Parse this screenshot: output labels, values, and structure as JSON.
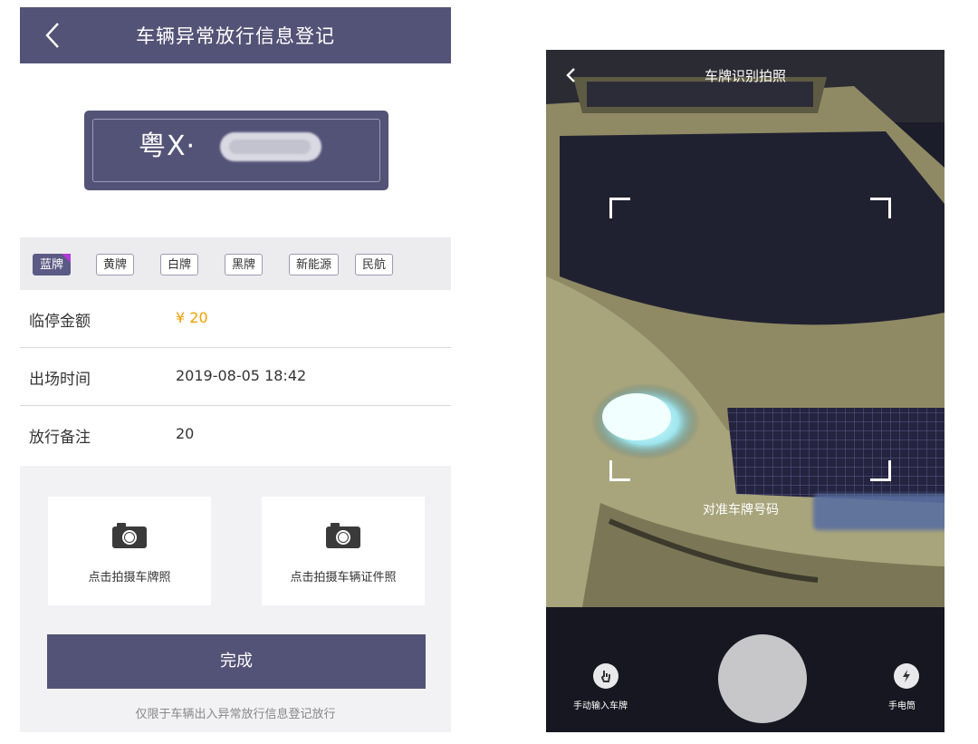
{
  "left_screen": {
    "header": {
      "title": "车辆异常放行信息登记"
    },
    "plate": {
      "prefix": "粤X·"
    },
    "plate_types": [
      {
        "label": "蓝牌",
        "selected": true
      },
      {
        "label": "黄牌",
        "selected": false
      },
      {
        "label": "白牌",
        "selected": false
      },
      {
        "label": "黑牌",
        "selected": false
      },
      {
        "label": "新能源",
        "selected": false
      },
      {
        "label": "民航",
        "selected": false
      }
    ],
    "fields": {
      "fee": {
        "label": "临停金额",
        "value": "¥ 20"
      },
      "exit_time": {
        "label": "出场时间",
        "value": "2019-08-05 18:42"
      },
      "remark": {
        "label": "放行备注",
        "value": "20"
      }
    },
    "photo_cards": {
      "plate_photo": "点击拍摄车牌照",
      "vehicle_doc_photo": "点击拍摄车辆证件照"
    },
    "done_button": "完成",
    "footnote": "仅限于车辆出入异常放行信息登记放行"
  },
  "right_screen": {
    "title": "车牌识别拍照",
    "aim_hint": "对准车牌号码",
    "manual_input_label": "手动输入车牌",
    "flashlight_label": "手电筒"
  },
  "colors": {
    "header_bg": "#535377",
    "amount": "#f0a000",
    "selected_tag_mark": "#b23ad6"
  }
}
